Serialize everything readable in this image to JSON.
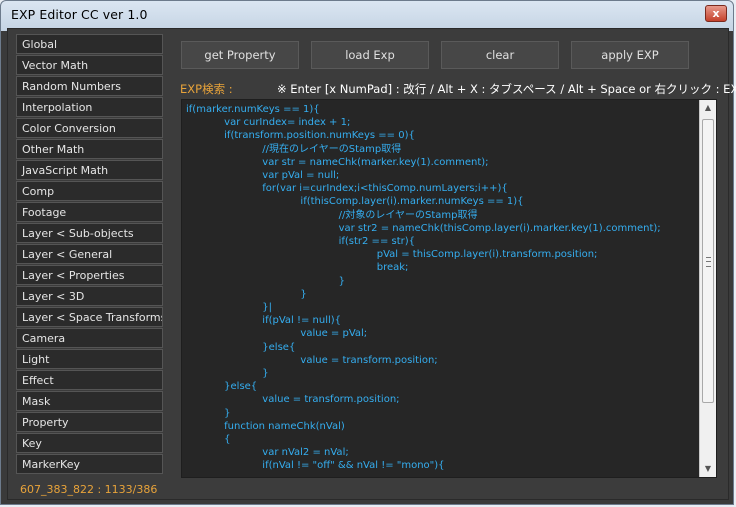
{
  "window": {
    "title": "EXP Editor CC  ver 1.0",
    "close_label": "x"
  },
  "sidebar": {
    "items": [
      {
        "label": "Global"
      },
      {
        "label": "Vector Math"
      },
      {
        "label": "Random Numbers"
      },
      {
        "label": "Interpolation"
      },
      {
        "label": "Color Conversion"
      },
      {
        "label": "Other Math"
      },
      {
        "label": "JavaScript Math"
      },
      {
        "label": "Comp"
      },
      {
        "label": "Footage"
      },
      {
        "label": "Layer < Sub-objects"
      },
      {
        "label": "Layer < General"
      },
      {
        "label": "Layer < Properties"
      },
      {
        "label": "Layer < 3D"
      },
      {
        "label": "Layer < Space Transforms"
      },
      {
        "label": "Camera"
      },
      {
        "label": "Light"
      },
      {
        "label": "Effect"
      },
      {
        "label": "Mask"
      },
      {
        "label": "Property"
      },
      {
        "label": "Key"
      },
      {
        "label": "MarkerKey"
      }
    ]
  },
  "status": {
    "text": "607_383_822 : 1133/386"
  },
  "toolbar": {
    "get_property": "get Property",
    "load_exp": "load Exp",
    "clear": "clear",
    "apply_exp": "apply EXP"
  },
  "search": {
    "label": "EXP検索 :",
    "hint": "※ Enter [x NumPad] : 改行 / Alt + X : タブスペース / Alt + Space or 右クリック : EXP検索"
  },
  "editor": {
    "code": "if(marker.numKeys == 1){\n            var curIndex= index + 1;\n            if(transform.position.numKeys == 0){\n                        //現在のレイヤーのStamp取得\n                        var str = nameChk(marker.key(1).comment);\n                        var pVal = null;\n                        for(var i=curIndex;i<thisComp.numLayers;i++){\n                                    if(thisComp.layer(i).marker.numKeys == 1){\n                                                //対象のレイヤーのStamp取得\n                                                var str2 = nameChk(thisComp.layer(i).marker.key(1).comment);\n                                                if(str2 == str){\n                                                            pVal = thisComp.layer(i).transform.position;\n                                                            break;\n                                                }\n                                    }\n                        }|\n                        if(pVal != null){\n                                    value = pVal;\n                        }else{\n                                    value = transform.position;\n                        }\n            }else{\n                        value = transform.position;\n            }\n            function nameChk(nVal)\n            {\n                        var nVal2 = nVal;\n                        if(nVal != \"off\" && nVal != \"mono\"){"
  },
  "colors": {
    "code_text": "#35aef0",
    "accent_orange": "#e8a33a",
    "panel_bg": "#3c3c3c",
    "editor_bg": "#262626"
  },
  "icons": {
    "scroll_up": "triangle-up",
    "scroll_down": "triangle-down"
  }
}
